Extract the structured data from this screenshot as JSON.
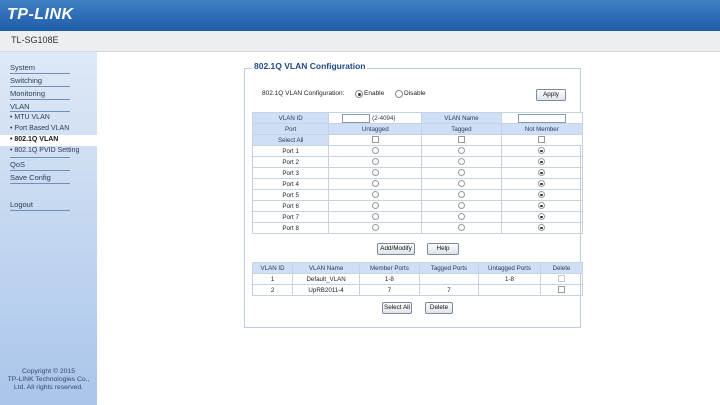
{
  "header": {
    "logo": "TP-LINK",
    "model": "TL-SG108E"
  },
  "sidebar": {
    "items": [
      {
        "label": "System"
      },
      {
        "label": "Switching"
      },
      {
        "label": "Monitoring"
      },
      {
        "label": "VLAN"
      },
      {
        "label": "• MTU VLAN"
      },
      {
        "label": "• Port Based VLAN"
      },
      {
        "label": "• 802.1Q VLAN"
      },
      {
        "label": "• 802.1Q PVID Setting"
      },
      {
        "label": "QoS"
      },
      {
        "label": "Save Config"
      },
      {
        "label": "Logout"
      }
    ],
    "copyright": [
      "Copyright © 2015",
      "TP-LINK Technologies Co.,",
      "Ltd. All rights reserved."
    ]
  },
  "main": {
    "title": "802.1Q VLAN Configuration",
    "config_label": "802.1Q VLAN Configuration:",
    "enable_label": "Enable",
    "disable_label": "Disable",
    "config_state": "enable",
    "apply_label": "Apply",
    "form": {
      "vlan_id_label": "VLAN ID",
      "vlan_id_value": "",
      "vlan_id_hint": "(2-4094)",
      "vlan_name_label": "VLAN Name",
      "vlan_name_value": "",
      "col_port": "Port",
      "col_untagged": "Untagged",
      "col_tagged": "Tagged",
      "col_not_member": "Not Member",
      "select_all": "Select All",
      "ports": [
        {
          "name": "Port 1",
          "state": "not_member"
        },
        {
          "name": "Port 2",
          "state": "not_member"
        },
        {
          "name": "Port 3",
          "state": "not_member"
        },
        {
          "name": "Port 4",
          "state": "not_member"
        },
        {
          "name": "Port 5",
          "state": "not_member"
        },
        {
          "name": "Port 6",
          "state": "not_member"
        },
        {
          "name": "Port 7",
          "state": "not_member"
        },
        {
          "name": "Port 8",
          "state": "not_member"
        }
      ],
      "add_modify_label": "Add/Modify",
      "help_label": "Help"
    },
    "vlan_table": {
      "headers": [
        "VLAN ID",
        "VLAN Name",
        "Member Ports",
        "Tagged Ports",
        "Untagged Ports",
        "Delete"
      ],
      "rows": [
        {
          "id": "1",
          "name": "Default_VLAN",
          "member": "1-8",
          "tagged": "",
          "untagged": "1-8"
        },
        {
          "id": "2",
          "name": "UpRB2011-4",
          "member": "7",
          "tagged": "7",
          "untagged": ""
        }
      ],
      "select_all_label": "Select All",
      "delete_label": "Delete"
    }
  }
}
